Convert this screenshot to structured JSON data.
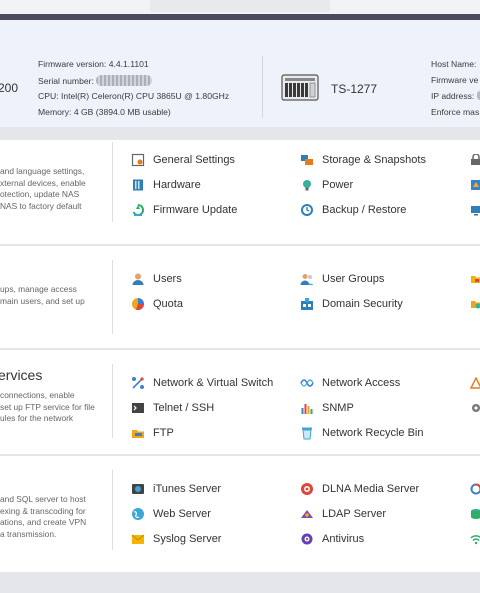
{
  "system_info": {
    "model_name_partial": "200",
    "firmware_label": "Firmware version:",
    "firmware_value": "4.4.1.1101",
    "serial_label": "Serial number:",
    "cpu_label": "CPU:",
    "cpu_value": "Intel(R) Celeron(R) CPU 3865U @ 1.80GHz",
    "memory_label": "Memory:",
    "memory_value": "4 GB (3894.0 MB usable)",
    "nas_model": "TS-1277",
    "host_name_label": "Host Name:",
    "firmware_partial_label": "Firmware ve",
    "ip_label": "IP address:",
    "enforce_partial_label": "Enforce mas"
  },
  "sections": {
    "system": {
      "desc": [
        "and language settings,",
        "xternal devices, enable",
        "otection, update NAS",
        "NAS to factory default"
      ],
      "items": {
        "general_settings": "General Settings",
        "hardware": "Hardware",
        "firmware_update": "Firmware Update",
        "storage_snapshots": "Storage & Snapshots",
        "power": "Power",
        "backup_restore": "Backup / Restore"
      }
    },
    "privilege": {
      "desc": [
        "ups, manage access",
        "main users, and set up"
      ],
      "items": {
        "users": "Users",
        "quota": "Quota",
        "user_groups": "User Groups",
        "domain_security": "Domain Security"
      }
    },
    "network": {
      "title": "ervices",
      "desc": [
        "connections, enable",
        "set up FTP service for file",
        "ules for the network"
      ],
      "items": {
        "network_virtual_switch": "Network & Virtual Switch",
        "telnet_ssh": "Telnet / SSH",
        "ftp": "FTP",
        "network_access": "Network Access",
        "snmp": "SNMP",
        "network_recycle_bin": "Network Recycle Bin"
      }
    },
    "applications": {
      "desc": [
        "and SQL server to host",
        "exing & transcoding for",
        "ations, and create VPN",
        "a transmission."
      ],
      "items": {
        "itunes_server": "iTunes Server",
        "web_server": "Web Server",
        "syslog_server": "Syslog Server",
        "dlna_media_server": "DLNA Media Server",
        "ldap_server": "LDAP Server",
        "antivirus": "Antivirus"
      }
    }
  },
  "colors": {
    "info_bg": "#eef3fb",
    "panel_bg": "#ffffff",
    "page_bg": "#e4e6ea",
    "top_bar": "#4b4a5e"
  }
}
